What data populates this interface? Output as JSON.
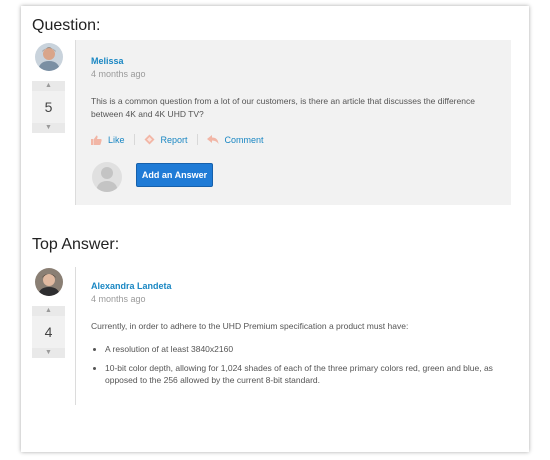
{
  "question": {
    "section_title": "Question:",
    "votes": "5",
    "author": "Melissa",
    "time": "4 months ago",
    "body": "This is a common question from a lot of our customers, is there an article that discusses the difference between 4K and 4K UHD TV?",
    "actions": {
      "like": "Like",
      "report": "Report",
      "comment": "Comment"
    },
    "add_answer": "Add an Answer"
  },
  "answer": {
    "section_title": "Top Answer:",
    "votes": "4",
    "author": "Alexandra Landeta",
    "time": "4 months ago",
    "intro": "Currently, in order to adhere to the UHD Premium specification a product must have:",
    "bullets": [
      "A resolution of at least 3840x2160",
      "10-bit color depth, allowing for 1,024 shades of each of the three primary colors red, green and blue, as opposed to the 256 allowed by the current 8-bit standard."
    ]
  },
  "colors": {
    "link": "#1a87c3",
    "button": "#1f7bd6",
    "panel": "#f2f2f2"
  },
  "icons": {
    "like": "thumbs-up-icon",
    "report": "flag-diamond-icon",
    "comment": "reply-arrow-icon",
    "vote_up": "up-triangle-icon",
    "vote_down": "down-triangle-icon"
  }
}
